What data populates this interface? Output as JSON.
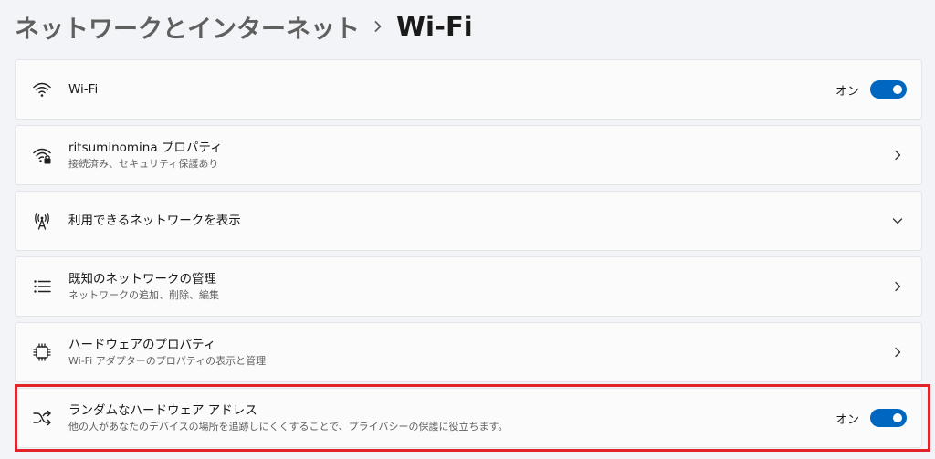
{
  "breadcrumb": {
    "parent": "ネットワークとインターネット",
    "separator": "›",
    "current": "Wi-Fi"
  },
  "rows": [
    {
      "id": "wifi",
      "icon": "wifi-icon",
      "title": "Wi-Fi",
      "subtitle": "",
      "control": "toggle",
      "toggle_label": "オン",
      "toggle_on": true
    },
    {
      "id": "network-properties",
      "icon": "wifi-lock-icon",
      "title": "ritsuminomina プロパティ",
      "subtitle": "接続済み、セキュリティ保護あり",
      "control": "chevron-right"
    },
    {
      "id": "available-networks",
      "icon": "antenna-icon",
      "title": "利用できるネットワークを表示",
      "subtitle": "",
      "control": "chevron-down"
    },
    {
      "id": "known-networks",
      "icon": "list-icon",
      "title": "既知のネットワークの管理",
      "subtitle": "ネットワークの追加、削除、編集",
      "control": "chevron-right"
    },
    {
      "id": "hardware-properties",
      "icon": "chip-icon",
      "title": "ハードウェアのプロパティ",
      "subtitle": "Wi-Fi アダプターのプロパティの表示と管理",
      "control": "chevron-right"
    },
    {
      "id": "random-hardware-address",
      "icon": "shuffle-icon",
      "title": "ランダムなハードウェア アドレス",
      "subtitle": "他の人があなたのデバイスの場所を追跡しにくくすることで、プライバシーの保護に役立ちます。",
      "control": "toggle",
      "toggle_label": "オン",
      "toggle_on": true,
      "highlighted": true
    }
  ],
  "colors": {
    "accent": "#0067c0",
    "highlight": "#e2242a",
    "background": "#f3f4f7",
    "card": "#fbfbfc"
  }
}
